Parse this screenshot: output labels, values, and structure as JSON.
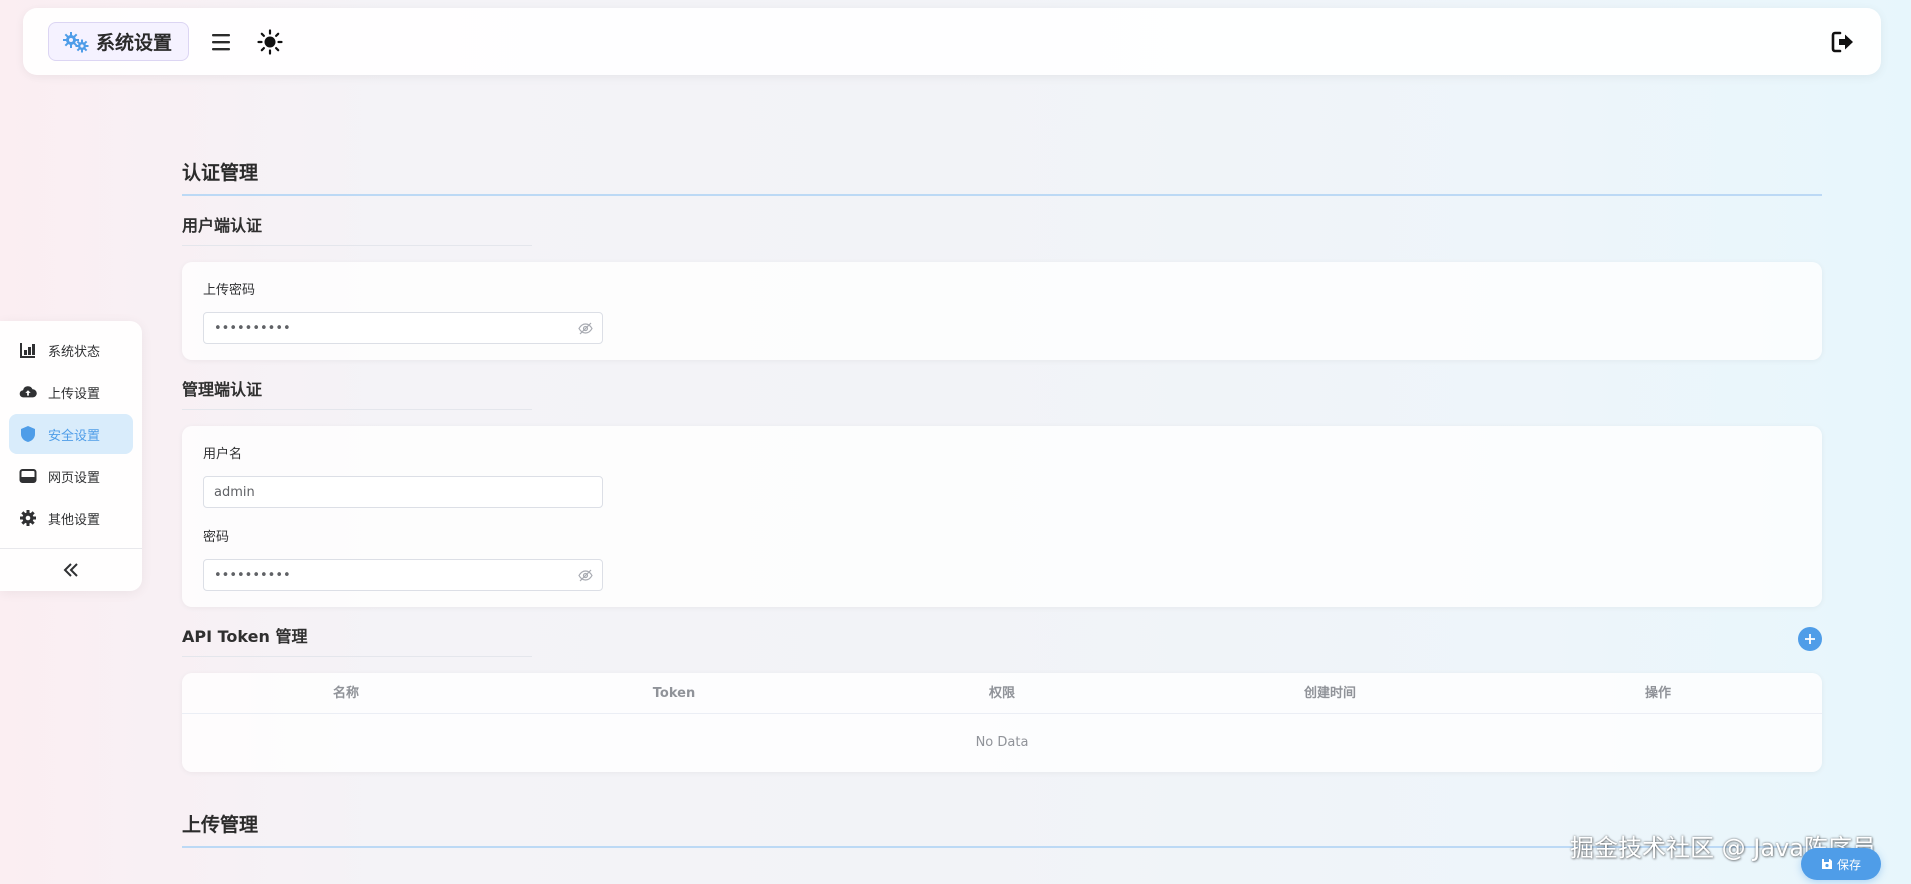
{
  "header": {
    "title": "系统设置",
    "icons": {
      "brand": "gears-icon",
      "menu": "hamburger-icon",
      "theme": "sun-icon",
      "logout": "logout-icon"
    }
  },
  "sidebar": {
    "items": [
      {
        "label": "系统状态",
        "icon": "chart-icon",
        "active": false
      },
      {
        "label": "上传设置",
        "icon": "cloud-upload-icon",
        "active": false
      },
      {
        "label": "安全设置",
        "icon": "shield-icon",
        "active": true
      },
      {
        "label": "网页设置",
        "icon": "window-icon",
        "active": false
      },
      {
        "label": "其他设置",
        "icon": "gear-icon",
        "active": false
      }
    ],
    "collapse_icon": "double-chevron-left-icon"
  },
  "auth": {
    "title": "认证管理",
    "user": {
      "title": "用户端认证",
      "upload_password_label": "上传密码",
      "upload_password_value": "••••••••••"
    },
    "admin": {
      "title": "管理端认证",
      "username_label": "用户名",
      "username_value": "admin",
      "password_label": "密码",
      "password_value": "••••••••••"
    },
    "api_token": {
      "title": "API Token 管理",
      "columns": [
        "名称",
        "Token",
        "权限",
        "创建时间",
        "操作"
      ],
      "empty_text": "No Data"
    }
  },
  "upload": {
    "title": "上传管理"
  },
  "save_button": "保存",
  "watermark": "掘金技术社区 @ Java陈序员",
  "colors": {
    "accent": "#4f9de8",
    "active_bg": "#d9ecfb"
  }
}
